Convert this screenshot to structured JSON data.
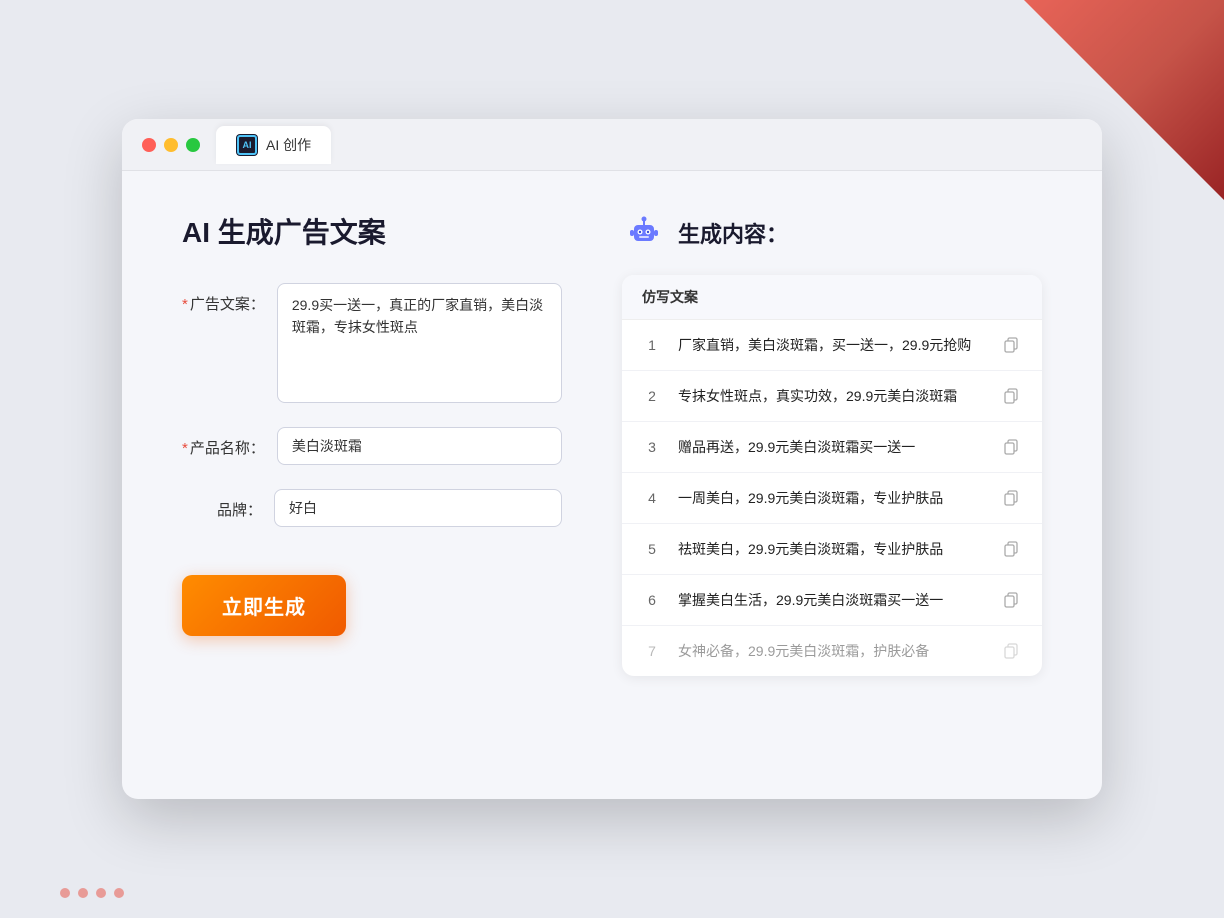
{
  "background": {
    "deco_bg": "#e8eaf0"
  },
  "window": {
    "tab_label": "AI 创作",
    "tab_icon_text": "AI"
  },
  "left_panel": {
    "page_title": "AI 生成广告文案",
    "form": {
      "ad_copy_label": "广告文案：",
      "ad_copy_required": "*",
      "ad_copy_value": "29.9买一送一，真正的厂家直销，美白淡斑霜，专抹女性斑点",
      "product_name_label": "产品名称：",
      "product_name_required": "*",
      "product_name_value": "美白淡斑霜",
      "brand_label": "品牌：",
      "brand_value": "好白",
      "generate_btn_label": "立即生成"
    }
  },
  "right_panel": {
    "result_header_label": "生成内容：",
    "column_header": "仿写文案",
    "results": [
      {
        "num": "1",
        "text": "厂家直销，美白淡斑霜，买一送一，29.9元抢购",
        "faded": false
      },
      {
        "num": "2",
        "text": "专抹女性斑点，真实功效，29.9元美白淡斑霜",
        "faded": false
      },
      {
        "num": "3",
        "text": "赠品再送，29.9元美白淡斑霜买一送一",
        "faded": false
      },
      {
        "num": "4",
        "text": "一周美白，29.9元美白淡斑霜，专业护肤品",
        "faded": false
      },
      {
        "num": "5",
        "text": "祛斑美白，29.9元美白淡斑霜，专业护肤品",
        "faded": false
      },
      {
        "num": "6",
        "text": "掌握美白生活，29.9元美白淡斑霜买一送一",
        "faded": false
      },
      {
        "num": "7",
        "text": "女神必备，29.9元美白淡斑霜，护肤必备",
        "faded": true
      }
    ]
  }
}
